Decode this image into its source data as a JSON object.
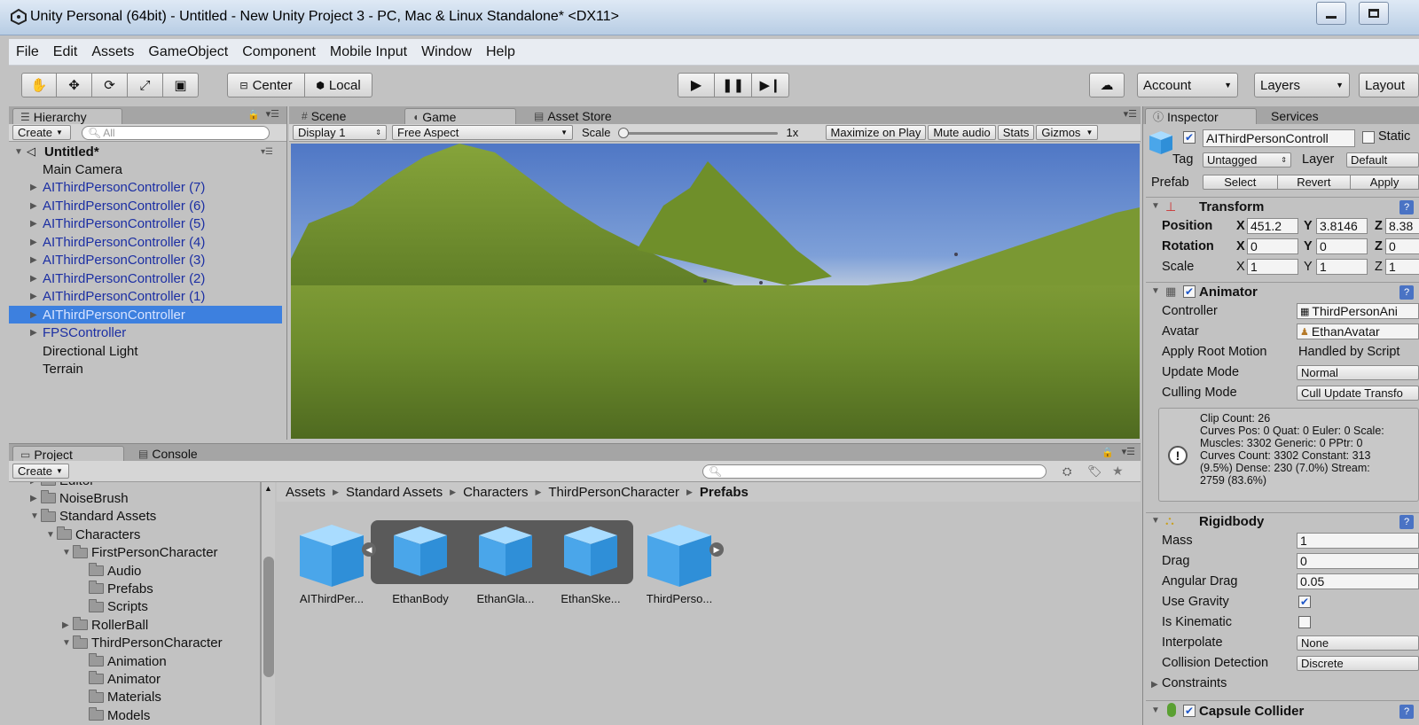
{
  "window": {
    "title": "Unity Personal (64bit) - Untitled - New Unity Project 3 - PC, Mac & Linux Standalone* <DX11>",
    "controls": [
      "minimize",
      "maximize"
    ]
  },
  "menu": [
    "File",
    "Edit",
    "Assets",
    "GameObject",
    "Component",
    "Mobile Input",
    "Window",
    "Help"
  ],
  "toolbar": {
    "transform_tools": [
      "hand-icon",
      "move-icon",
      "rotate-icon",
      "scale-icon",
      "rect-icon"
    ],
    "pivot": "Center",
    "space": "Local",
    "play_controls": [
      "play-icon",
      "pause-icon",
      "step-icon"
    ],
    "account": "Account",
    "layers": "Layers",
    "layout": "Layout"
  },
  "hierarchy": {
    "tab": "Hierarchy",
    "create": "Create",
    "search_placeholder": "All",
    "scene": "Untitled*",
    "items": [
      {
        "label": "Main Camera",
        "prefab": false,
        "expandable": false
      },
      {
        "label": "AIThirdPersonController (7)",
        "prefab": true,
        "expandable": true
      },
      {
        "label": "AIThirdPersonController (6)",
        "prefab": true,
        "expandable": true
      },
      {
        "label": "AIThirdPersonController (5)",
        "prefab": true,
        "expandable": true
      },
      {
        "label": "AIThirdPersonController (4)",
        "prefab": true,
        "expandable": true
      },
      {
        "label": "AIThirdPersonController (3)",
        "prefab": true,
        "expandable": true
      },
      {
        "label": "AIThirdPersonController (2)",
        "prefab": true,
        "expandable": true
      },
      {
        "label": "AIThirdPersonController (1)",
        "prefab": true,
        "expandable": true
      },
      {
        "label": "AIThirdPersonController",
        "prefab": true,
        "expandable": true,
        "selected": true
      },
      {
        "label": "FPSController",
        "prefab": true,
        "expandable": true
      },
      {
        "label": "Directional Light",
        "prefab": false,
        "expandable": false
      },
      {
        "label": "Terrain",
        "prefab": false,
        "expandable": false
      }
    ]
  },
  "center_tabs": [
    "Scene",
    "Game",
    "Asset Store"
  ],
  "game_bar": {
    "display": "Display 1",
    "aspect": "Free Aspect",
    "scale_label": "Scale",
    "scale_value": "1x",
    "maximize": "Maximize on Play",
    "mute": "Mute audio",
    "stats": "Stats",
    "gizmos": "Gizmos"
  },
  "project": {
    "tabs": [
      "Project",
      "Console"
    ],
    "create": "Create",
    "tree": [
      {
        "label": "Editor",
        "depth": 1,
        "arrow": "right"
      },
      {
        "label": "NoiseBrush",
        "depth": 1,
        "arrow": "right"
      },
      {
        "label": "Standard Assets",
        "depth": 1,
        "arrow": "down"
      },
      {
        "label": "Characters",
        "depth": 2,
        "arrow": "down"
      },
      {
        "label": "FirstPersonCharacter",
        "depth": 3,
        "arrow": "down"
      },
      {
        "label": "Audio",
        "depth": 4,
        "arrow": "none"
      },
      {
        "label": "Prefabs",
        "depth": 4,
        "arrow": "none"
      },
      {
        "label": "Scripts",
        "depth": 4,
        "arrow": "none"
      },
      {
        "label": "RollerBall",
        "depth": 3,
        "arrow": "right"
      },
      {
        "label": "ThirdPersonCharacter",
        "depth": 3,
        "arrow": "down"
      },
      {
        "label": "Animation",
        "depth": 4,
        "arrow": "none"
      },
      {
        "label": "Animator",
        "depth": 4,
        "arrow": "none"
      },
      {
        "label": "Materials",
        "depth": 4,
        "arrow": "none"
      },
      {
        "label": "Models",
        "depth": 4,
        "arrow": "none"
      }
    ],
    "breadcrumb": [
      "Assets",
      "Standard Assets",
      "Characters",
      "ThirdPersonCharacter",
      "Prefabs"
    ],
    "assets": [
      "AIThirdPer...",
      "EthanBody",
      "EthanGla...",
      "EthanSke...",
      "ThirdPerso..."
    ]
  },
  "inspector": {
    "tabs": [
      "Inspector",
      "Services"
    ],
    "object_name": "AIThirdPersonControll",
    "static_label": "Static",
    "tag_label": "Tag",
    "tag_value": "Untagged",
    "layer_label": "Layer",
    "layer_value": "Default",
    "prefab_label": "Prefab",
    "prefab_buttons": [
      "Select",
      "Revert",
      "Apply"
    ],
    "transform": {
      "title": "Transform",
      "position": {
        "label": "Position",
        "x": "451.2",
        "y": "3.8146",
        "z": "8.38"
      },
      "rotation": {
        "label": "Rotation",
        "x": "0",
        "y": "0",
        "z": "0"
      },
      "scale": {
        "label": "Scale",
        "x": "1",
        "y": "1",
        "z": "1"
      },
      "axis": [
        "X",
        "Y",
        "Z"
      ]
    },
    "animator": {
      "title": "Animator",
      "controller_label": "Controller",
      "controller_value": "ThirdPersonAni",
      "avatar_label": "Avatar",
      "avatar_value": "EthanAvatar",
      "root_motion_label": "Apply Root Motion",
      "root_motion_value": "Handled by Script",
      "update_mode_label": "Update Mode",
      "update_mode_value": "Normal",
      "culling_label": "Culling Mode",
      "culling_value": "Cull Update Transfo",
      "info": [
        "Clip Count: 26",
        "Curves Pos: 0 Quat: 0 Euler: 0 Scale:",
        "Muscles: 3302 Generic: 0 PPtr: 0",
        "Curves Count: 3302 Constant: 313",
        "(9.5%) Dense: 230 (7.0%) Stream:",
        "2759 (83.6%)"
      ]
    },
    "rigidbody": {
      "title": "Rigidbody",
      "mass_label": "Mass",
      "mass": "1",
      "drag_label": "Drag",
      "drag": "0",
      "angular_label": "Angular Drag",
      "angular": "0.05",
      "gravity_label": "Use Gravity",
      "gravity": true,
      "kinematic_label": "Is Kinematic",
      "kinematic": false,
      "interpolate_label": "Interpolate",
      "interpolate": "None",
      "collision_label": "Collision Detection",
      "collision": "Discrete",
      "constraints_label": "Constraints"
    },
    "capsule": {
      "title": "Capsule Collider"
    }
  }
}
